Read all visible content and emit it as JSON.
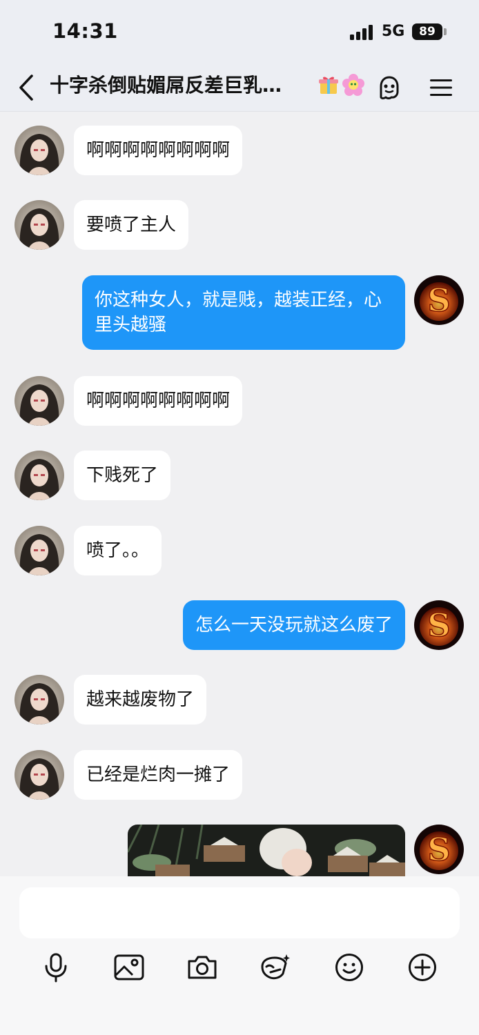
{
  "status_bar": {
    "time": "14:31",
    "network": "5G",
    "battery": "89"
  },
  "header": {
    "title": "十字杀倒贴媚屌反差巨乳…"
  },
  "messages": [
    {
      "side": "in",
      "text": "啊啊啊啊啊啊啊啊"
    },
    {
      "side": "in",
      "text": "要喷了主人"
    },
    {
      "side": "out",
      "text": "你这种女人，就是贱，越装正经，心里头越骚"
    },
    {
      "side": "in",
      "text": "啊啊啊啊啊啊啊啊"
    },
    {
      "side": "in",
      "text": "下贱死了"
    },
    {
      "side": "in",
      "text": "喷了。。"
    },
    {
      "side": "out",
      "text": "怎么一天没玩就这么废了"
    },
    {
      "side": "in",
      "text": "越来越废物了"
    },
    {
      "side": "in",
      "text": "已经是烂肉一摊了"
    }
  ],
  "input": {
    "value": ""
  },
  "colors": {
    "outgoing_bubble": "#1e96f8",
    "incoming_bubble": "#ffffff",
    "background": "#f0f0f2"
  },
  "icons": [
    "back-icon",
    "gift-icon",
    "flower-icon",
    "ghost-icon",
    "menu-icon",
    "microphone-icon",
    "image-icon",
    "camera-icon",
    "sticker-icon",
    "emoji-icon",
    "plus-icon"
  ]
}
